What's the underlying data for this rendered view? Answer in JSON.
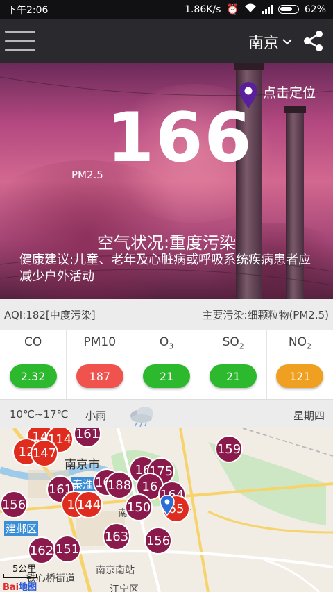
{
  "status_bar": {
    "time": "下午2:06",
    "speed": "1.86K/s",
    "battery": "62%"
  },
  "header": {
    "city": "南京"
  },
  "hero": {
    "aqi_value": "166",
    "pollutant_label": "PM2.5",
    "locate_label": "点击定位",
    "air_status": "空气状况:重度污染",
    "advice": "健康建议:儿童、老年及心脏病或呼吸系统疾病患者应减少户外活动"
  },
  "aqi_row": {
    "aqi": "AQI:182[中度污染]",
    "main_pollutant": "主要污染:细颗粒物(PM2.5)"
  },
  "pollutants": [
    {
      "name": "CO",
      "sub": "",
      "value": "2.32",
      "color": "#2db92d"
    },
    {
      "name": "PM10",
      "sub": "",
      "value": "187",
      "color": "#f0524e"
    },
    {
      "name": "O",
      "sub": "3",
      "value": "21",
      "color": "#2db92d"
    },
    {
      "name": "SO",
      "sub": "2",
      "value": "21",
      "color": "#2db92d"
    },
    {
      "name": "NO",
      "sub": "2",
      "value": "121",
      "color": "#f0a020"
    }
  ],
  "weather": {
    "temp": "10℃~17℃",
    "condition": "小雨",
    "weekday": "星期四"
  },
  "map": {
    "labels": {
      "city": "南京市",
      "qinhuai": "秦淮区",
      "jianye": "建邺区",
      "nanjing_south": "南京南站",
      "tiexin": "铁心桥街道",
      "jiangning": "江宁区",
      "nan": "南",
      "gong": "工"
    },
    "scale": "5公里",
    "brand_baidu": "Bai",
    "brand_map": "地图",
    "markers": [
      "14",
      "114",
      "161",
      "12",
      "147",
      "159",
      "161",
      "16",
      "175",
      "161",
      "188",
      "16",
      "164",
      "156",
      "144",
      "150",
      "65",
      "163",
      "156",
      "162",
      "151",
      "13"
    ]
  }
}
